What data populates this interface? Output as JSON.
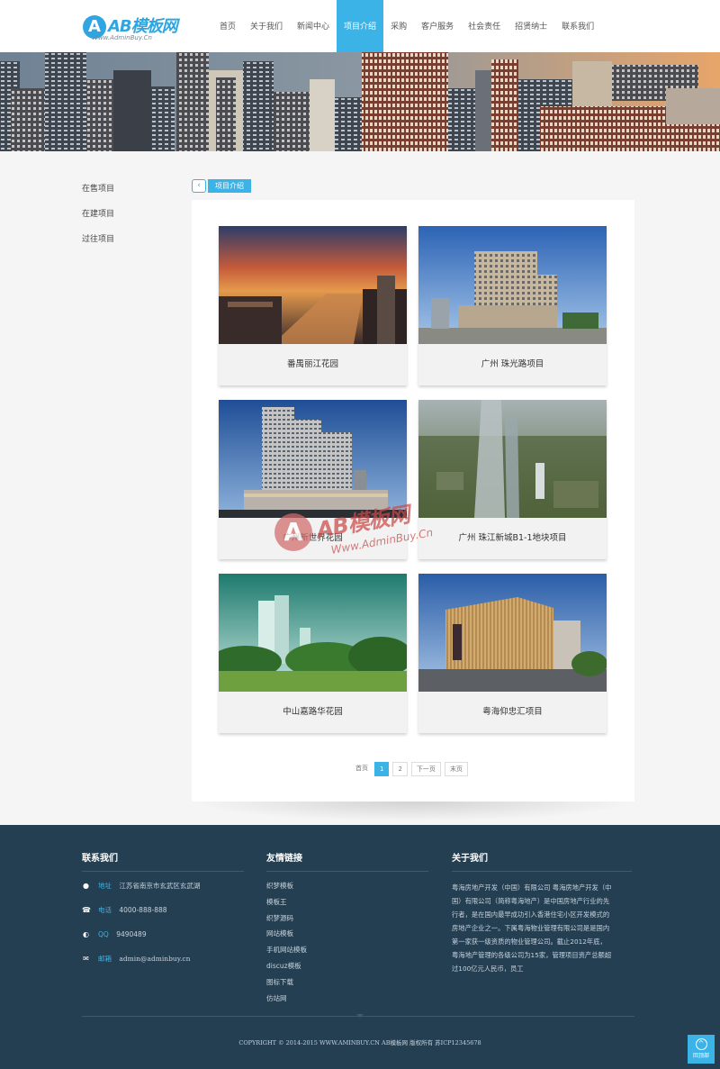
{
  "logo": {
    "mark": "A",
    "title": "AB模板网",
    "subtitle": "Www.AdminBuy.Cn"
  },
  "nav": {
    "items": [
      {
        "label": "首页"
      },
      {
        "label": "关于我们"
      },
      {
        "label": "新闻中心"
      },
      {
        "label": "项目介绍",
        "active": true
      },
      {
        "label": "采购"
      },
      {
        "label": "客户服务"
      },
      {
        "label": "社会责任"
      },
      {
        "label": "招贤纳士"
      },
      {
        "label": "联系我们"
      }
    ]
  },
  "sidebar": {
    "items": [
      {
        "label": "在售项目"
      },
      {
        "label": "在建项目"
      },
      {
        "label": "过往项目"
      }
    ]
  },
  "breadcrumb": {
    "icon": "back-arrow-icon",
    "label": "项目介绍"
  },
  "projects": [
    {
      "title": "番禺丽江花园",
      "image": "sunset-river-city"
    },
    {
      "title": "广州 珠光路项目",
      "image": "apartment-tower-blue-sky"
    },
    {
      "title": "广州新世界花园",
      "image": "highrise-complex-dusk"
    },
    {
      "title": "广州 珠江新城B1-1地块项目",
      "image": "aerial-city-render"
    },
    {
      "title": "中山嘉路华花园",
      "image": "towers-among-trees"
    },
    {
      "title": "粤海仰忠汇项目",
      "image": "commercial-building-dusk"
    }
  ],
  "pagination": {
    "first": "首页",
    "pages": [
      "1",
      "2"
    ],
    "current": "1",
    "next": "下一页",
    "last": "末页"
  },
  "watermark": {
    "mark": "A",
    "title": "AB模板网",
    "subtitle": "Www.AdminBuy.Cn"
  },
  "footer": {
    "contact": {
      "heading": "联系我们",
      "rows": [
        {
          "icon": "location-pin-icon",
          "label": "地址",
          "value": "江苏省南京市玄武区玄武湖"
        },
        {
          "icon": "phone-icon",
          "label": "电话",
          "value": "4000-888-888"
        },
        {
          "icon": "qq-icon",
          "label": "QQ",
          "value": "9490489"
        },
        {
          "icon": "mail-icon",
          "label": "邮箱",
          "value": "admin@adminbuy.cn"
        }
      ]
    },
    "links": {
      "heading": "友情链接",
      "items": [
        "织梦模板",
        "模板王",
        "织梦源码",
        "网站模板",
        "手机网站模板",
        "discuz模板",
        "图标下载",
        "仿站网"
      ]
    },
    "about": {
      "heading": "关于我们",
      "text": "粤海房地产开发（中国）有限公司 粤海房地产开发（中国）有限公司（简称粤海地产）是中国房地产行业的先行者，是在国内最早成功引入香港住宅小区开发模式的房地产企业之一。下属粤海物业管理有限公司是是国内第一家获一级资质的物业管理公司。截止2012年底，粤海地产管理的各级公司为15家，管理项目资产总额超过100亿元人民币，员工"
    },
    "copyright": "COPYRIGHT © 2014-2015 WWW.AMINBUY.CN AB模板网 版权所有 苏ICP12345678",
    "totop_label": "回顶部"
  },
  "colors": {
    "accent": "#3cb3e6",
    "footer_bg": "#243e52"
  }
}
